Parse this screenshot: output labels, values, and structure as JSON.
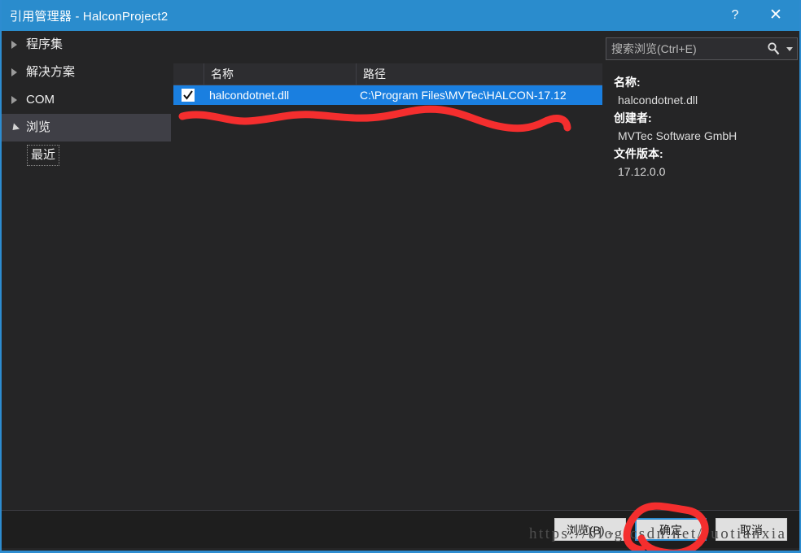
{
  "window": {
    "title": "引用管理器 - HalconProject2",
    "help_label": "?",
    "close_label": "✕",
    "accent_color": "#2a8ccd",
    "selection_color": "#1a7fe0",
    "annotation_color": "#f42e2e"
  },
  "sidebar": {
    "items": [
      {
        "label": "程序集",
        "state": "collapsed",
        "level": 1,
        "selected": false
      },
      {
        "label": "解决方案",
        "state": "collapsed",
        "level": 1,
        "selected": false
      },
      {
        "label": "COM",
        "state": "collapsed",
        "level": 1,
        "selected": false
      },
      {
        "label": "浏览",
        "state": "expanded",
        "level": 1,
        "selected": true
      },
      {
        "label": "最近",
        "state": "leaf",
        "level": 2,
        "selected": false
      }
    ]
  },
  "list": {
    "columns": [
      {
        "key": "check",
        "label": ""
      },
      {
        "key": "name",
        "label": "名称"
      },
      {
        "key": "path",
        "label": "路径"
      }
    ],
    "rows": [
      {
        "checked": true,
        "name": "halcondotnet.dll",
        "path": "C:\\Program Files\\MVTec\\HALCON-17.12",
        "selected": true
      }
    ],
    "scrollbar": {
      "left_arrow": "◀",
      "right_arrow": "▶",
      "thumb_position_percent": 0,
      "thumb_width_percent": 79
    }
  },
  "search": {
    "value": "",
    "placeholder": "搜索浏览(Ctrl+E)",
    "icon": "search-icon",
    "dropdown_icon": "chevron-down-icon"
  },
  "details": [
    {
      "key": "名称:",
      "value": "halcondotnet.dll"
    },
    {
      "key": "创建者:",
      "value": "MVTec Software GmbH"
    },
    {
      "key": "文件版本:",
      "value": "17.12.0.0"
    }
  ],
  "footer": {
    "browse_label": "浏览(B)...",
    "ok_label": "确定",
    "cancel_label": "取消"
  },
  "watermark": {
    "text": "https://blog.csdn.net/ruotianxia"
  }
}
